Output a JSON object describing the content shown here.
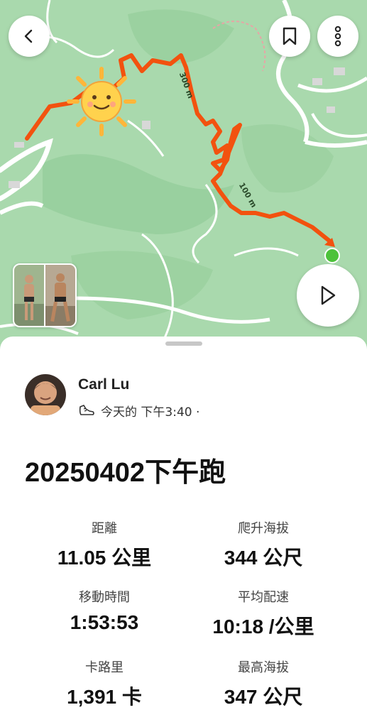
{
  "map": {
    "route_labels": [
      "300 m",
      "100 m"
    ],
    "colors": {
      "route": "#f2520f",
      "end_marker": "#4cc23a",
      "land": "#a9d9ad",
      "roads": "#ffffff"
    },
    "icons": {
      "back": "chevron-left-icon",
      "bookmark": "bookmark-icon",
      "more": "more-vertical-icon",
      "play": "play-icon",
      "sun": "sun-sticker-icon"
    }
  },
  "activity": {
    "athlete_name": "Carl Lu",
    "time_meta": "今天的 下午3:40 ·",
    "title": "20250402下午跑"
  },
  "stats": [
    {
      "label": "距離",
      "value": "11.05 公里"
    },
    {
      "label": "爬升海拔",
      "value": "344 公尺"
    },
    {
      "label": "移動時間",
      "value": "1:53:53"
    },
    {
      "label": "平均配速",
      "value": "10:18 /公里"
    },
    {
      "label": "卡路里",
      "value": "1,391 卡"
    },
    {
      "label": "最高海拔",
      "value": "347 公尺"
    }
  ]
}
